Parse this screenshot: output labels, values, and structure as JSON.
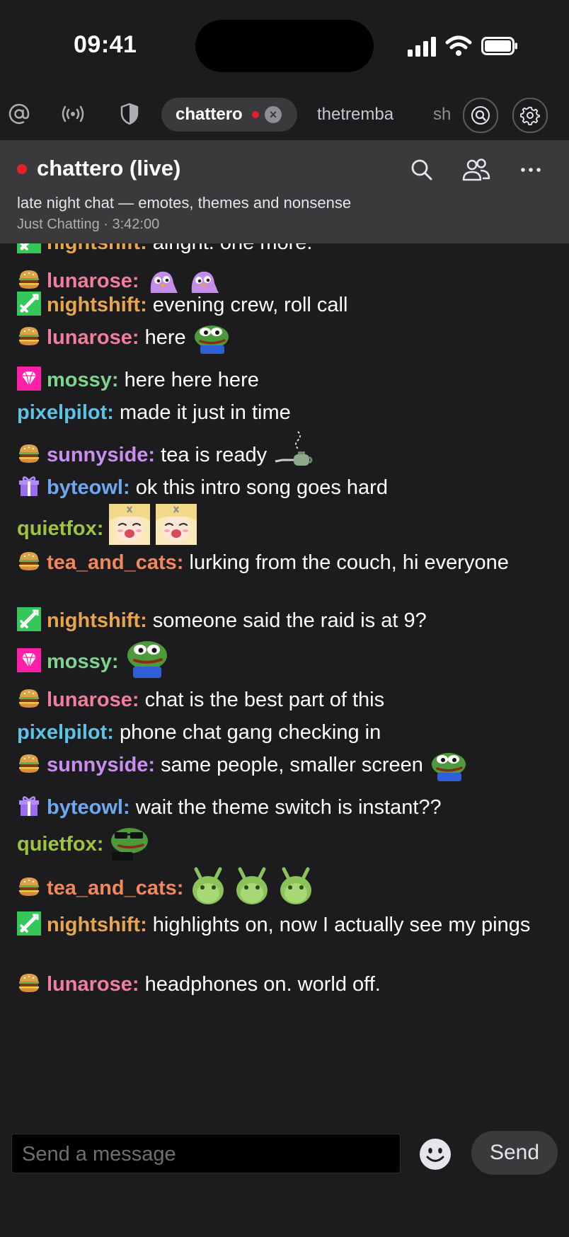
{
  "status_bar": {
    "time": "09:41"
  },
  "tabs": {
    "icons": [
      "mentions-icon",
      "live-icon",
      "moderation-shield-icon"
    ],
    "active": {
      "label": "chattero",
      "live": true
    },
    "others": [
      "thetremba",
      "sh"
    ]
  },
  "channel": {
    "title": "chattero (live)",
    "description": "late night chat — emotes, themes and nonsense",
    "meta": "Just Chatting · 3:42:00"
  },
  "colors": {
    "nightshift": "#e8a64c",
    "lunarose": "#f27e9d",
    "mossy": "#7ed38e",
    "pixelpilot": "#5ec2e6",
    "sunnyside": "#c98ef0",
    "byteowl": "#6fa8f0",
    "quietfox": "#9dc43f",
    "tea_and_cats": "#f2875a"
  },
  "messages": [
    {
      "user": "nightshift:",
      "badge": "sword",
      "text": "alright. one more.",
      "emotes": []
    },
    {
      "user": "lunarose:",
      "badge": "burger",
      "text": "",
      "emotes": [
        "bird",
        "bird"
      ]
    },
    {
      "user": "nightshift:",
      "badge": "sword",
      "text": "evening crew, roll call",
      "emotes": []
    },
    {
      "user": "lunarose:",
      "badge": "burger",
      "text": "here",
      "emotes": [
        "pepe"
      ]
    },
    {
      "user": "mossy:",
      "badge": "gem",
      "text": "here here here",
      "emotes": []
    },
    {
      "user": "pixelpilot:",
      "badge": "",
      "text": "made it just in time",
      "emotes": []
    },
    {
      "user": "sunnyside:",
      "badge": "burger",
      "text": "tea is ready",
      "emotes": [
        "teapot"
      ]
    },
    {
      "user": "byteowl:",
      "badge": "gift",
      "text": "ok this intro song goes hard",
      "emotes": []
    },
    {
      "user": "quietfox:",
      "badge": "",
      "text": "",
      "emotes": [
        "anime",
        "anime"
      ]
    },
    {
      "user": "tea_and_cats:",
      "badge": "burger",
      "text": "lurking from the couch, hi everyone",
      "emotes": []
    },
    {
      "user": "nightshift:",
      "badge": "sword",
      "text": "someone said the raid is at 9?",
      "emotes": []
    },
    {
      "user": "mossy:",
      "badge": "gem",
      "text": "",
      "emotes": [
        "pepe-big"
      ]
    },
    {
      "user": "lunarose:",
      "badge": "burger",
      "text": "chat is the best part of this",
      "emotes": []
    },
    {
      "user": "pixelpilot:",
      "badge": "",
      "text": "phone chat gang checking in",
      "emotes": []
    },
    {
      "user": "sunnyside:",
      "badge": "burger",
      "text": "same people, smaller screen",
      "emotes": [
        "pepe"
      ]
    },
    {
      "user": "byteowl:",
      "badge": "gift",
      "text": "wait the theme switch is instant??",
      "emotes": []
    },
    {
      "user": "quietfox:",
      "badge": "",
      "text": "",
      "emotes": [
        "pepe-shades"
      ]
    },
    {
      "user": "tea_and_cats:",
      "badge": "burger",
      "text": "",
      "emotes": [
        "cat",
        "cat",
        "cat"
      ]
    },
    {
      "user": "nightshift:",
      "badge": "sword",
      "text": "highlights on, now I actually see my pings",
      "emotes": []
    },
    {
      "user": "lunarose:",
      "badge": "burger",
      "text": "headphones on. world off.",
      "emotes": []
    }
  ],
  "input": {
    "placeholder": "Send a message",
    "send_label": "Send"
  }
}
